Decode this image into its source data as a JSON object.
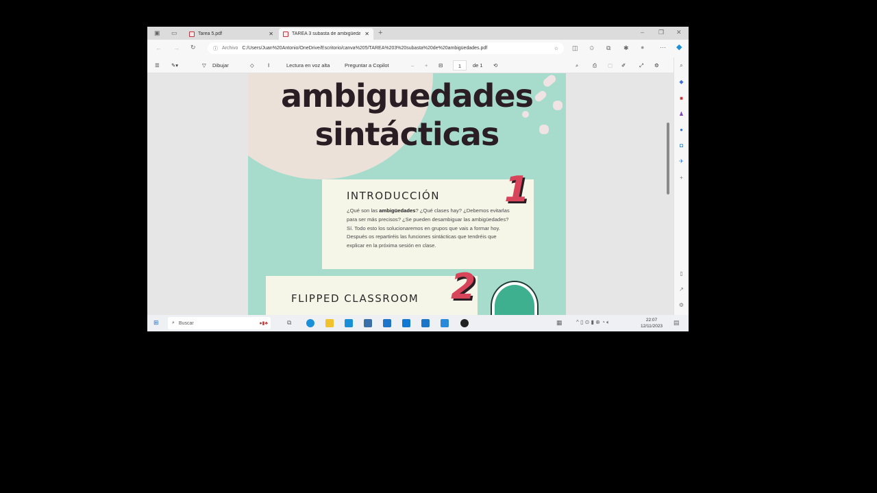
{
  "tabs": [
    {
      "label": "Tarea 5.pdf"
    },
    {
      "label": "TAREA 3 subasta de ambigüedad"
    }
  ],
  "address": {
    "scheme_label": "Archivo",
    "url": "C:/Users/Juan%20Antonio/OneDrive/Escritorio/canva%205/TAREA%203%20subasta%20de%20ambigüedades.pdf"
  },
  "pdf_toolbar": {
    "draw": "Dibujar",
    "read_aloud": "Lectura en voz alta",
    "copilot": "Preguntar a Copilot",
    "page": "1",
    "page_total": "de 1"
  },
  "document": {
    "title_line1": "ambiguedades",
    "title_line2": "sintácticas",
    "section1": {
      "number": "1",
      "heading": "INTRODUCCIÓN",
      "text_before": "¿Qué son las ",
      "bold": "ambigüedades",
      "text_after": "? ¿Qué clases hay? ¿Debemos evitarlas para ser más precisos? ¿Se pueden desambiguar las ambigüedades? Sí. Todo esto los solucionaremos en grupos que vais a formar hoy. Después os repartiréis las funciones sintácticas que tendréis que explicar en la próxima sesión en clase."
    },
    "section2": {
      "number": "2",
      "heading": "FLIPPED CLASSROOM"
    }
  },
  "taskbar": {
    "search_placeholder": "Buscar",
    "time": "22:07",
    "date": "12/11/2023"
  },
  "colors": {
    "page_bg": "#a7dccd",
    "accent_red": "#d8455a",
    "card": "#f5f5e8"
  }
}
